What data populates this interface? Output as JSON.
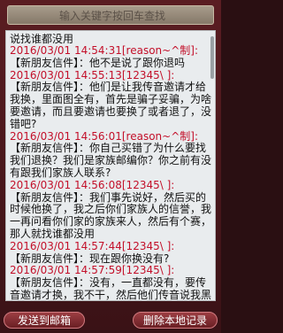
{
  "search": {
    "placeholder": "输入关键字按回车查找"
  },
  "messages": [
    {
      "ts": "",
      "body": "说找谁都没用"
    },
    {
      "ts": "2016/03/01 14:54:31[reason~^制]:",
      "body": "【新朋友信件】：他不是说了跟你退吗"
    },
    {
      "ts": "2016/03/01 14:55:13[12345\\ ]:",
      "body": "【新朋友信件】：他们是让我传音邀请才给我换，里面图全有，首先是骗子妥骗，为啥要邀请，而且要邀请也要换了或者退了，没错吧?"
    },
    {
      "ts": "2016/03/01 14:56:01[reason~^制]:",
      "body": "【新朋友信件】：你自己买错了为什么要找我们退换？我们是家族邮编你？你之前有没有跟我们家族人联系?"
    },
    {
      "ts": "2016/03/01 14:56:08[12345\\ ]:",
      "body": "【新朋友信件】：我们事先说好，然后买的时候他换了，我之后你们家族人的信誉，我一再问看你们家的家族来人，然后有个赛，那人就找谁都没用"
    },
    {
      "ts": "2016/03/01 14:57:44[12345\\ ]:",
      "body": "【新朋友信件】：现在跟你换没有?"
    },
    {
      "ts": "2016/03/01 14:57:59[12345\\ ]:",
      "body": "【新朋友信件】：没有，一直都没有，要传音邀请才换，我不干，然后他们传音说我黑他们，还强行说"
    }
  ],
  "buttons": {
    "send_mail": "发送到邮箱",
    "delete_local": "删除本地记录"
  }
}
